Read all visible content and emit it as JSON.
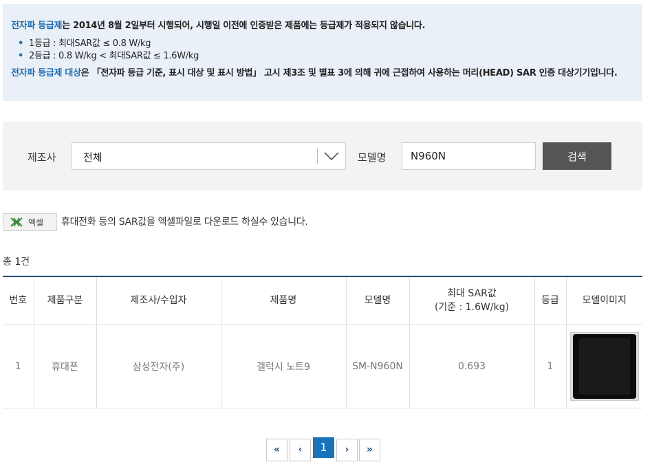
{
  "info": {
    "line1_term": "전자파 등급제",
    "line1_rest": "는 2014년 8월 2일부터 시행되어, 시행일 이전에 인증받은 제품에는 등급제가 적용되지 않습니다.",
    "bullets": [
      "1등급 : 최대SAR값 ≤ 0.8 W/kg",
      "2등급 : 0.8 W/kg < 최대SAR값 ≤ 1.6W/kg"
    ],
    "line2_term": "전자파 등급제 대상",
    "line2_rest": "은 「전자파 등급 기준, 표시 대상 및 표시 방법」 고시 제3조 및 별표 3에 의해 귀에 근접하여 사용하는 머리(HEAD) SAR 인증 대상기기입니다."
  },
  "search": {
    "maker_label": "제조사",
    "maker_value": "전체",
    "model_label": "모델명",
    "model_value": "N960N",
    "button_label": "검색"
  },
  "excel": {
    "button_label": "엑셀",
    "description": "휴대전화 등의 SAR값을 엑셀파일로 다운로드 하실수 있습니다."
  },
  "total": {
    "prefix": "총 ",
    "count": "1",
    "suffix": "건"
  },
  "table": {
    "headers": {
      "no": "번호",
      "category": "제품구분",
      "maker": "제조사/수입자",
      "product": "제품명",
      "model": "모델명",
      "sar_line1": "최대 SAR값",
      "sar_line2": "(기준 : 1.6W/kg)",
      "grade": "등급",
      "image": "모델이미지"
    },
    "rows": [
      {
        "no": "1",
        "category": "휴대폰",
        "maker": "삼성전자(주)",
        "product": "갤럭시 노트9",
        "model": "SM-N960N",
        "sar": "0.693",
        "grade": "1"
      }
    ]
  },
  "pager": {
    "first": "«",
    "prev": "‹",
    "current": "1",
    "next": "›",
    "last": "»"
  },
  "colors": {
    "accent": "#1f6db3",
    "info_bg": "#eaf0f7",
    "search_bg": "#f3f3f3",
    "button_dark": "#555555",
    "table_top_border": "#1f4e7a",
    "pager_active": "#1a72b8"
  }
}
